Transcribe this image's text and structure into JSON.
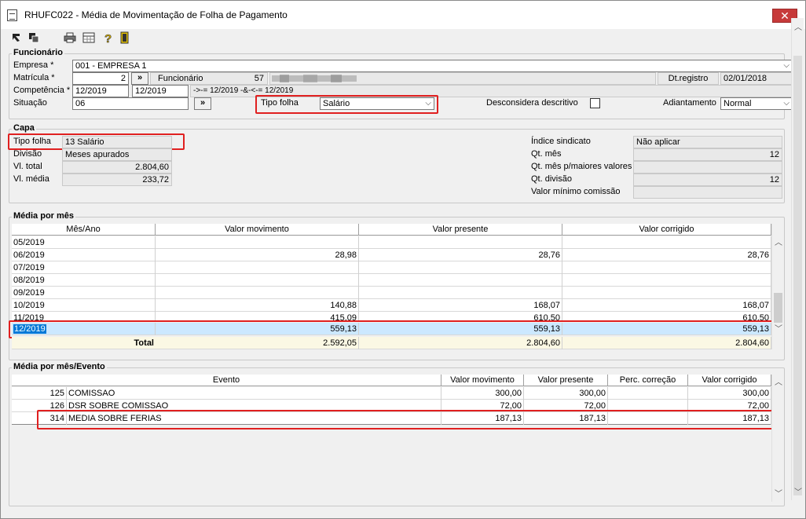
{
  "window": {
    "title": "RHUFC022 - Média de Movimentação de Folha de Pagamento",
    "close": "✕"
  },
  "funcionario": {
    "section": "Funcionário",
    "empresa_label": "Empresa *",
    "empresa_value": "001 - EMPRESA 1",
    "matricula_label": "Matrícula *",
    "matricula_value": "2",
    "funcionario_label": "Funcionário",
    "funcionario_num": "57",
    "dtregistro_label": "Dt.registro",
    "dtregistro_value": "02/01/2018",
    "competencia_label": "Competência *",
    "competencia_de": "12/2019",
    "competencia_ate": "12/2019",
    "competencia_text": "->-= 12/2019 -&-<-= 12/2019",
    "situacao_label": "Situação",
    "situacao_value": "06",
    "tipo_folha_label": "Tipo folha",
    "tipo_folha_value": "Salário",
    "desconsidera_label": "Desconsidera descritivo",
    "adiantamento_label": "Adiantamento",
    "adiantamento_value": "Normal",
    "lookup_btn": "»"
  },
  "capa": {
    "section": "Capa",
    "tipo_folha_label": "Tipo folha",
    "tipo_folha_value": "13 Salário",
    "divisao_label": "Divisão",
    "divisao_value": "Meses apurados",
    "vl_total_label": "Vl. total",
    "vl_total_value": "2.804,60",
    "vl_media_label": "Vl. média",
    "vl_media_value": "233,72",
    "indice_label": "Índice sindicato",
    "indice_value": "Não aplicar",
    "qt_mes_label": "Qt. mês",
    "qt_mes_value": "12",
    "qt_mes_maiores_label": "Qt. mês p/maiores valores",
    "qt_mes_maiores_value": "",
    "qt_divisao_label": "Qt. divisão",
    "qt_divisao_value": "12",
    "valor_minimo_label": "Valor mínimo comissão",
    "valor_minimo_value": ""
  },
  "media_mes": {
    "section": "Média por mês",
    "columns": [
      "Mês/Ano",
      "Valor movimento",
      "Valor presente",
      "Valor corrigido"
    ],
    "rows": [
      [
        "05/2019",
        "",
        "",
        ""
      ],
      [
        "06/2019",
        "28,98",
        "28,76",
        "28,76"
      ],
      [
        "07/2019",
        "",
        "",
        ""
      ],
      [
        "08/2019",
        "",
        "",
        ""
      ],
      [
        "09/2019",
        "",
        "",
        ""
      ],
      [
        "10/2019",
        "140,88",
        "168,07",
        "168,07"
      ],
      [
        "11/2019",
        "415,09",
        "610,50",
        "610,50"
      ],
      [
        "12/2019",
        "559,13",
        "559,13",
        "559,13"
      ]
    ],
    "total_label": "Total",
    "total": [
      "2.592,05",
      "2.804,60",
      "2.804,60"
    ]
  },
  "media_evento": {
    "section": "Média por mês/Evento",
    "columns": [
      "Evento",
      "Valor movimento",
      "Valor presente",
      "Perc. correção",
      "Valor corrigido"
    ],
    "rows": [
      [
        "125",
        "COMISSAO",
        "300,00",
        "300,00",
        "",
        "300,00"
      ],
      [
        "126",
        "DSR SOBRE COMISSAO",
        "72,00",
        "72,00",
        "",
        "72,00"
      ],
      [
        "314",
        "MEDIA SOBRE FERIAS",
        "187,13",
        "187,13",
        "",
        "187,13"
      ]
    ]
  },
  "icons": [
    "arrow-first-icon",
    "copy-icon",
    "printer-icon",
    "calculator-icon",
    "help-icon",
    "exit-door-icon"
  ],
  "colors": {
    "highlight": "#e02020",
    "selected_row": "#cce8ff",
    "total_row": "#fbf8e4",
    "close": "#c73a3a"
  }
}
